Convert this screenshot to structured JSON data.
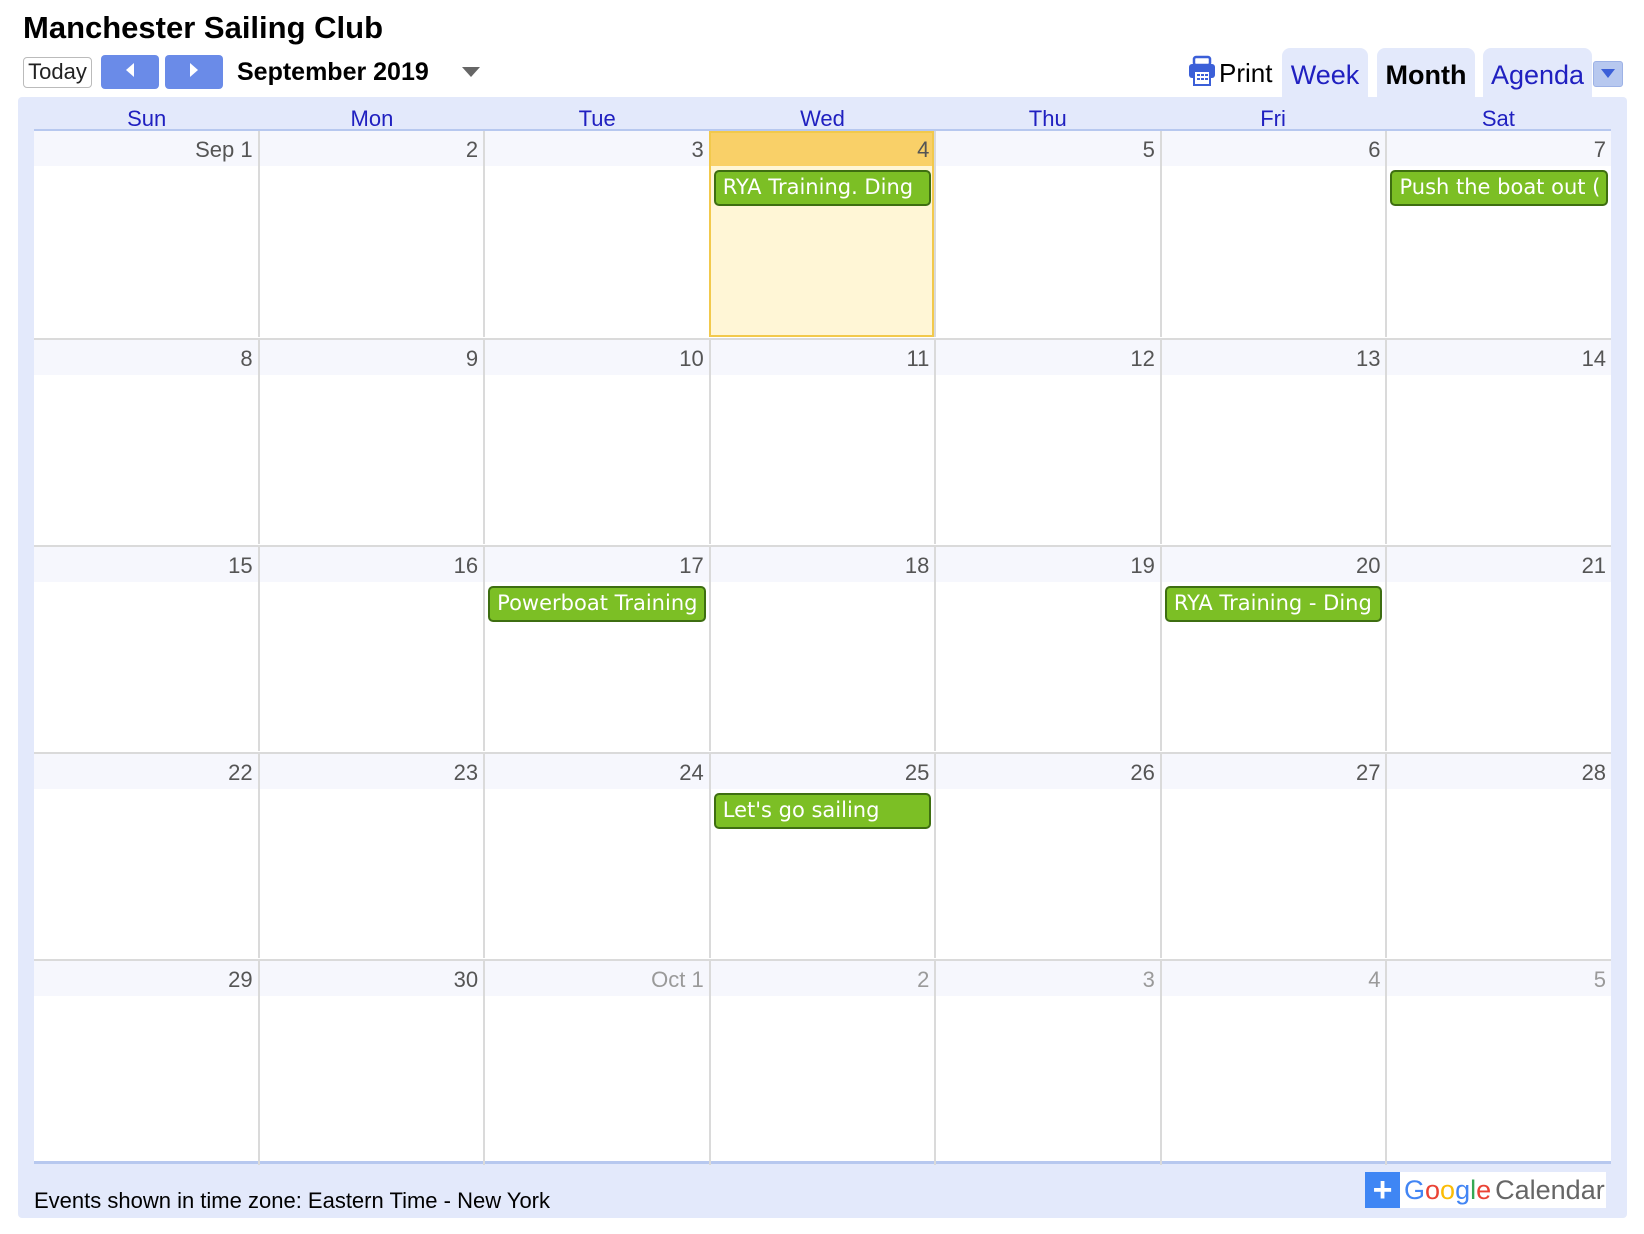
{
  "header": {
    "title": "Manchester Sailing Club",
    "today_label": "Today",
    "prev_icon": "chevron-left-icon",
    "next_icon": "chevron-right-icon",
    "month_label": "September 2019",
    "month_dropdown_icon": "caret-down-icon",
    "print_label": "Print",
    "print_icon": "printer-icon"
  },
  "tabs": [
    {
      "label": "Week",
      "active": false
    },
    {
      "label": "Month",
      "active": true
    },
    {
      "label": "Agenda",
      "active": false
    }
  ],
  "days_of_week": [
    "Sun",
    "Mon",
    "Tue",
    "Wed",
    "Thu",
    "Fri",
    "Sat"
  ],
  "weeks": [
    [
      {
        "label": "Sep 1",
        "other_month": false
      },
      {
        "label": "2",
        "other_month": false
      },
      {
        "label": "3",
        "other_month": false
      },
      {
        "label": "4",
        "other_month": false,
        "today": true,
        "event": "RYA Training. Ding"
      },
      {
        "label": "5",
        "other_month": false
      },
      {
        "label": "6",
        "other_month": false
      },
      {
        "label": "7",
        "other_month": false,
        "event": "Push the boat out ("
      }
    ],
    [
      {
        "label": "8"
      },
      {
        "label": "9"
      },
      {
        "label": "10"
      },
      {
        "label": "11"
      },
      {
        "label": "12"
      },
      {
        "label": "13"
      },
      {
        "label": "14"
      }
    ],
    [
      {
        "label": "15"
      },
      {
        "label": "16"
      },
      {
        "label": "17",
        "event": "Powerboat Training"
      },
      {
        "label": "18"
      },
      {
        "label": "19"
      },
      {
        "label": "20",
        "event": "RYA Training - Ding"
      },
      {
        "label": "21"
      }
    ],
    [
      {
        "label": "22"
      },
      {
        "label": "23"
      },
      {
        "label": "24"
      },
      {
        "label": "25",
        "event": "Let's go sailing"
      },
      {
        "label": "26"
      },
      {
        "label": "27"
      },
      {
        "label": "28"
      }
    ],
    [
      {
        "label": "29"
      },
      {
        "label": "30"
      },
      {
        "label": "Oct 1",
        "other_month": true
      },
      {
        "label": "2",
        "other_month": true
      },
      {
        "label": "3",
        "other_month": true
      },
      {
        "label": "4",
        "other_month": true
      },
      {
        "label": "5",
        "other_month": true
      }
    ]
  ],
  "footer": {
    "timezone_text": "Events shown in time zone: Eastern Time - New York",
    "badge_plus": "+",
    "badge_google": "Google",
    "badge_calendar": "Calendar"
  },
  "colors": {
    "event_bg": "#7cbf25",
    "event_border": "#3e6e11",
    "today_head": "#f9d068",
    "today_bg": "#fff6d6",
    "frame_bg": "#e3e9fb",
    "nav_button": "#6a8be8",
    "link_blue": "#2020c0"
  }
}
